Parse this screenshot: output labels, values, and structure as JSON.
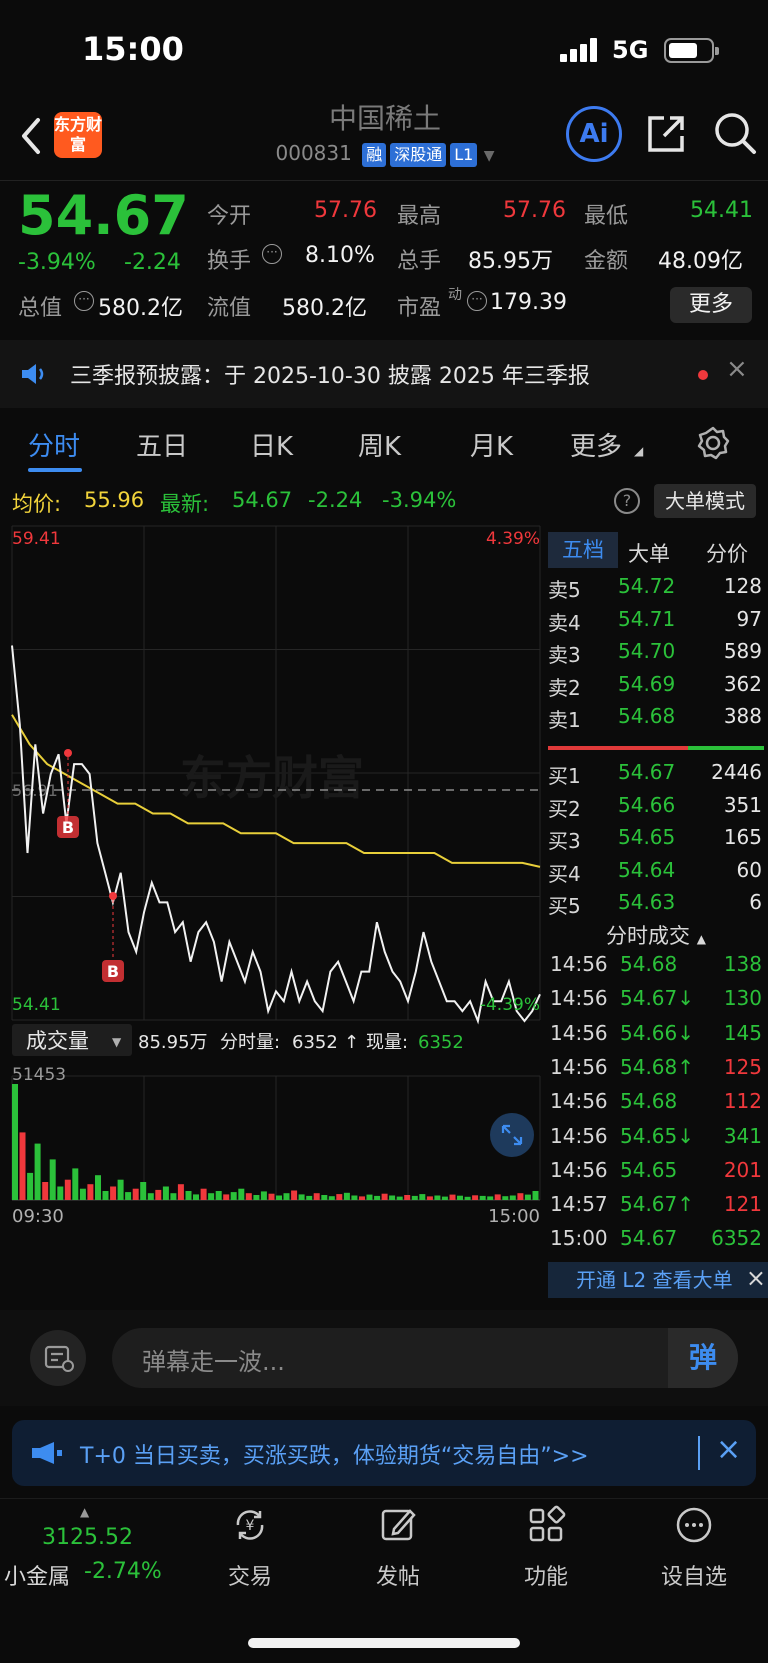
{
  "status": {
    "time": "15:00",
    "network": "5G"
  },
  "header": {
    "logo_text": "东方财富",
    "stock_name": "中国稀土",
    "stock_code": "000831",
    "tags": [
      "融",
      "深股通",
      "L1"
    ]
  },
  "quote": {
    "price": "54.67",
    "change_pct": "-3.94%",
    "change": "-2.24",
    "fields": {
      "open_label": "今开",
      "open": "57.76",
      "high_label": "最高",
      "high": "57.76",
      "low_label": "最低",
      "low": "54.41",
      "turnover_label": "换手",
      "turnover": "8.10%",
      "volume_label": "总手",
      "volume": "85.95万",
      "amount_label": "金额",
      "amount": "48.09亿",
      "mktcap_label": "总值",
      "mktcap": "580.2亿",
      "float_label": "流值",
      "float": "580.2亿",
      "pe_label": "市盈",
      "pe_sup": "动",
      "pe": "179.39"
    },
    "more_label": "更多"
  },
  "notice": {
    "text": "三季报预披露：于 2025-10-30 披露 2025 年三季报"
  },
  "tabs": [
    "分时",
    "五日",
    "日K",
    "周K",
    "月K",
    "更多"
  ],
  "info_bar": {
    "avg_label": "均价:",
    "avg": "55.96",
    "latest_label": "最新:",
    "latest": "54.67",
    "chg": "-2.24",
    "chg_pct": "-3.94%",
    "mode_button": "大单模式"
  },
  "chart_data": {
    "type": "line",
    "y_max_label": "59.41",
    "y_min_label": "54.41",
    "pct_max_label": "4.39%",
    "pct_min_label": "-4.39%",
    "ref_label": "56.91",
    "watermark": "东方财富",
    "x_start": "09:30",
    "x_end": "15:00",
    "ylim": [
      54.41,
      59.41
    ],
    "series": [
      {
        "values": [
          58.2,
          57.4,
          56.1,
          57.2,
          56.5,
          56.9,
          57.1,
          56.4,
          57.0,
          57.0,
          56.9,
          56.2,
          55.9,
          55.6,
          55.9,
          55.3,
          55.1,
          55.5,
          55.8,
          55.6,
          55.6,
          55.3,
          55.4,
          55.0,
          55.3,
          55.4,
          55.2,
          54.8,
          55.2,
          55.0,
          54.8,
          55.1,
          54.9,
          54.5,
          54.7,
          54.6,
          54.9,
          54.6,
          54.8,
          54.6,
          54.5,
          54.9,
          55.0,
          54.8,
          54.6,
          54.9,
          54.9,
          55.4,
          55.1,
          54.9,
          54.8,
          54.6,
          54.9,
          55.3,
          55.0,
          54.8,
          54.6,
          54.6,
          54.5,
          54.6,
          54.4,
          54.8,
          54.6,
          54.6,
          54.8,
          54.5,
          54.4,
          54.5,
          54.67
        ]
      },
      {
        "values": [
          57.5,
          57.2,
          57.0,
          56.9,
          56.8,
          56.7,
          56.6,
          56.6,
          56.5,
          56.5,
          56.4,
          56.4,
          56.4,
          56.3,
          56.3,
          56.3,
          56.2,
          56.2,
          56.2,
          56.2,
          56.1,
          56.1,
          56.1,
          56.1,
          56.1,
          56.0,
          56.0,
          56.0,
          56.0,
          56.0,
          55.96
        ]
      }
    ],
    "markers": [
      "B",
      "B"
    ],
    "volume_label": "成交量",
    "volume_total": "85.95万",
    "volume_tick_label": "分时量:",
    "volume_tick": "6352",
    "volume_now_label": "现量:",
    "volume_now": "6352",
    "volume_max": "51453",
    "volume_bars": [
      51453,
      30000,
      12000,
      25000,
      8000,
      18000,
      6000,
      9000,
      14000,
      5000,
      7000,
      11000,
      4000,
      6000,
      9000,
      3500,
      5000,
      8000,
      3000,
      4500,
      6000,
      3000,
      7000,
      4000,
      2500,
      5000,
      3000,
      4000,
      2500,
      3500,
      5000,
      3000,
      2200,
      3800,
      2800,
      2000,
      3000,
      4200,
      2500,
      1800,
      3000,
      2200,
      1700,
      2600,
      3200,
      2000,
      1600,
      2400,
      1800,
      2800,
      2000,
      1500,
      2200,
      1800,
      2600,
      1600,
      2000,
      1500,
      2400,
      1900,
      1400,
      2100,
      1800,
      1600,
      2500,
      1700,
      2000,
      3000,
      2400,
      4000
    ]
  },
  "orderbook": {
    "tabs": [
      "五档",
      "大单",
      "分价"
    ],
    "asks": [
      {
        "label": "卖5",
        "price": "54.72",
        "vol": "128"
      },
      {
        "label": "卖4",
        "price": "54.71",
        "vol": "97"
      },
      {
        "label": "卖3",
        "price": "54.70",
        "vol": "589"
      },
      {
        "label": "卖2",
        "price": "54.69",
        "vol": "362"
      },
      {
        "label": "卖1",
        "price": "54.68",
        "vol": "388"
      }
    ],
    "bids": [
      {
        "label": "买1",
        "price": "54.67",
        "vol": "2446"
      },
      {
        "label": "买2",
        "price": "54.66",
        "vol": "351"
      },
      {
        "label": "买3",
        "price": "54.65",
        "vol": "165"
      },
      {
        "label": "买4",
        "price": "54.64",
        "vol": "60"
      },
      {
        "label": "买5",
        "price": "54.63",
        "vol": "6"
      }
    ]
  },
  "ticks": {
    "title": "分时成交",
    "rows": [
      {
        "time": "14:56",
        "price": "54.68",
        "vol": "138",
        "dir": "",
        "color": "green"
      },
      {
        "time": "14:56",
        "price": "54.67↓",
        "vol": "130",
        "dir": "",
        "color": "green"
      },
      {
        "time": "14:56",
        "price": "54.66↓",
        "vol": "145",
        "dir": "",
        "color": "green"
      },
      {
        "time": "14:56",
        "price": "54.68↑",
        "vol": "125",
        "dir": "",
        "color": "red"
      },
      {
        "time": "14:56",
        "price": "54.68",
        "vol": "112",
        "dir": "",
        "color": "red"
      },
      {
        "time": "14:56",
        "price": "54.65↓",
        "vol": "341",
        "dir": "",
        "color": "green"
      },
      {
        "time": "14:56",
        "price": "54.65",
        "vol": "201",
        "dir": "",
        "color": "red"
      },
      {
        "time": "14:57",
        "price": "54.67↑",
        "vol": "121",
        "dir": "",
        "color": "red"
      },
      {
        "time": "15:00",
        "price": "54.67",
        "vol": "6352",
        "dir": "",
        "color": "green"
      }
    ],
    "l2_banner": "开通 L2 查看大单"
  },
  "comment": {
    "placeholder": "弹幕走一波...",
    "send_icon_text": "弹"
  },
  "promo": {
    "text": "T+0 当日买卖，买涨买跌，体验期货“交易自由”>>"
  },
  "bottom_nav": {
    "index_value": "3125.52",
    "index_name": "小金属",
    "index_change": "-2.74%",
    "items": [
      "交易",
      "发帖",
      "功能",
      "设自选"
    ]
  }
}
